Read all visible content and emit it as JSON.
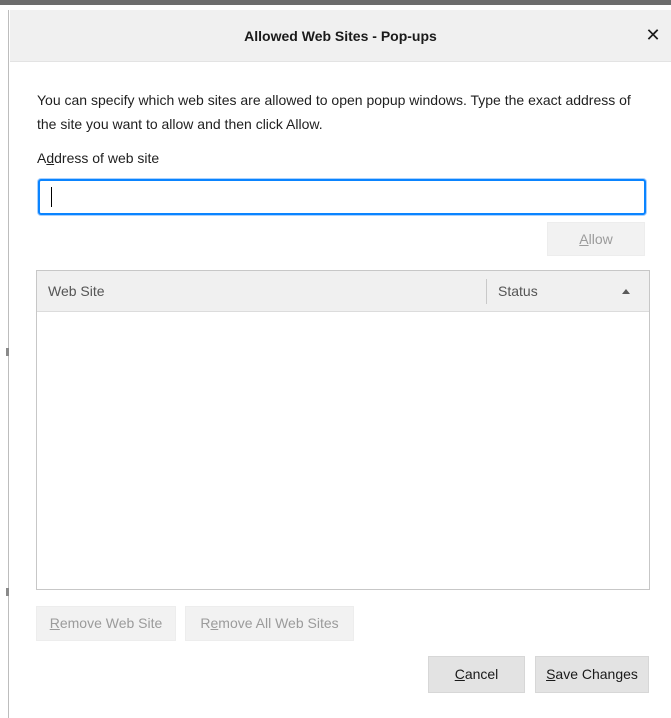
{
  "dialog": {
    "title": "Allowed Web Sites - Pop-ups",
    "close_glyph": "✕"
  },
  "description": "You can specify which web sites are allowed to open popup windows. Type the exact address of the site you want to allow and then click Allow.",
  "address_field": {
    "label_prefix": "A",
    "label_accesskey": "d",
    "label_suffix": "dress of web site",
    "value": "",
    "placeholder": ""
  },
  "allow_button": {
    "accesskey": "A",
    "label_rest": "llow"
  },
  "table": {
    "columns": [
      {
        "label": "Web Site"
      },
      {
        "label": "Status"
      }
    ],
    "rows": []
  },
  "actions": {
    "remove_site": {
      "accesskey": "R",
      "label_rest": "emove Web Site"
    },
    "remove_all": {
      "label_prefix": "R",
      "accesskey": "e",
      "label_rest": "move All Web Sites"
    },
    "cancel": {
      "accesskey": "C",
      "label_rest": "ancel"
    },
    "save": {
      "accesskey": "S",
      "label_rest": "ave Changes"
    }
  },
  "colors": {
    "focus_border": "#0a84ff",
    "header_bg": "#f0f0f0",
    "disabled_text": "#9b9b9b"
  }
}
